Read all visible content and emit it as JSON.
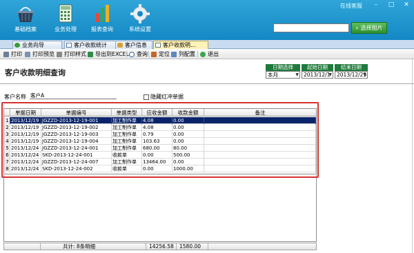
{
  "topbar": {
    "tools": [
      {
        "label": "基础档案",
        "icon": "basket-icon"
      },
      {
        "label": "业务处理",
        "icon": "calculator-icon"
      },
      {
        "label": "报表查询",
        "icon": "bar-chart-icon"
      },
      {
        "label": "系统设置",
        "icon": "gear-icon"
      }
    ],
    "status": "在线客服",
    "search_value": "",
    "select_image_button": "选择图片"
  },
  "tabs": [
    {
      "label": "业务向导",
      "active": false
    },
    {
      "label": "客户收款统计",
      "active": false
    },
    {
      "label": "客户信息",
      "active": false
    },
    {
      "label": "客户收款明...",
      "active": true
    }
  ],
  "toolbar": [
    {
      "label": "打印",
      "icon": "printer-icon"
    },
    {
      "label": "打印预览",
      "icon": "print-preview-icon"
    },
    {
      "label": "打印样式",
      "icon": "print-style-icon"
    },
    {
      "label": "导出到EXCEL",
      "icon": "excel-icon"
    },
    {
      "label": "查询",
      "icon": "magnifier-icon"
    },
    {
      "label": "定位",
      "icon": "locate-icon"
    },
    {
      "label": "列配置",
      "icon": "column-config-icon"
    },
    {
      "label": "退出",
      "icon": "exit-icon"
    }
  ],
  "page_title": "客户收款明细查询",
  "filters": {
    "date_range": {
      "header": "日期选择",
      "value": "本月"
    },
    "start_date": {
      "header": "起始日期",
      "value": "2013/12/1"
    },
    "end_date": {
      "header": "结束日期",
      "value": "2013/12/25"
    }
  },
  "customer": {
    "label": "客户名称",
    "value": "客户A"
  },
  "hide_reversal": {
    "label": "隐藏红冲单据",
    "checked": false
  },
  "grid": {
    "columns": [
      "单据日期",
      "单据编号",
      "单据类型",
      "应收金额",
      "收款金额",
      "备注"
    ],
    "rows": [
      {
        "no": "1",
        "date": "2013/12/19",
        "doc_no": "JGZZD-2013-12-19-001",
        "type": "加工制作单",
        "receivable": "4.08",
        "received": "0.00",
        "remark": ""
      },
      {
        "no": "2",
        "date": "2013/12/19",
        "doc_no": "JGZZD-2013-12-19-002",
        "type": "加工制作单",
        "receivable": "4.08",
        "received": "0.00",
        "remark": ""
      },
      {
        "no": "3",
        "date": "2013/12/19",
        "doc_no": "JGZZD-2013-12-19-003",
        "type": "加工制作单",
        "receivable": "0.79",
        "received": "0.00",
        "remark": ""
      },
      {
        "no": "4",
        "date": "2013/12/19",
        "doc_no": "JGZZD-2013-12-19-004",
        "type": "加工制作单",
        "receivable": "103.63",
        "received": "0.00",
        "remark": ""
      },
      {
        "no": "5",
        "date": "2013/12/24",
        "doc_no": "JGZZD-2013-12-24-001",
        "type": "加工制作单",
        "receivable": "680.00",
        "received": "80.00",
        "remark": ""
      },
      {
        "no": "6",
        "date": "2013/12/24",
        "doc_no": "SKD-2013-12-24-001",
        "type": "收款单",
        "receivable": "0.00",
        "received": "500.00",
        "remark": ""
      },
      {
        "no": "7",
        "date": "2013/12/24",
        "doc_no": "JGZZD-2013-12-24-007",
        "type": "加工制作单",
        "receivable": "13464.00",
        "received": "0.00",
        "remark": ""
      },
      {
        "no": "8",
        "date": "2013/12/24",
        "doc_no": "SKD-2013-12-24-002",
        "type": "收款单",
        "receivable": "0.00",
        "received": "1000.00",
        "remark": ""
      }
    ],
    "selected_row": 0
  },
  "footer": {
    "summary": "共计: 8条明细",
    "total_receivable": "14256.58",
    "total_received": "1580.00"
  },
  "colors": {
    "topbar": "#1b95cf",
    "filter_header": "#1f7a3c",
    "selection": "#0a246a",
    "highlight_frame": "#d93030",
    "active_tab": "#fff2b8"
  }
}
